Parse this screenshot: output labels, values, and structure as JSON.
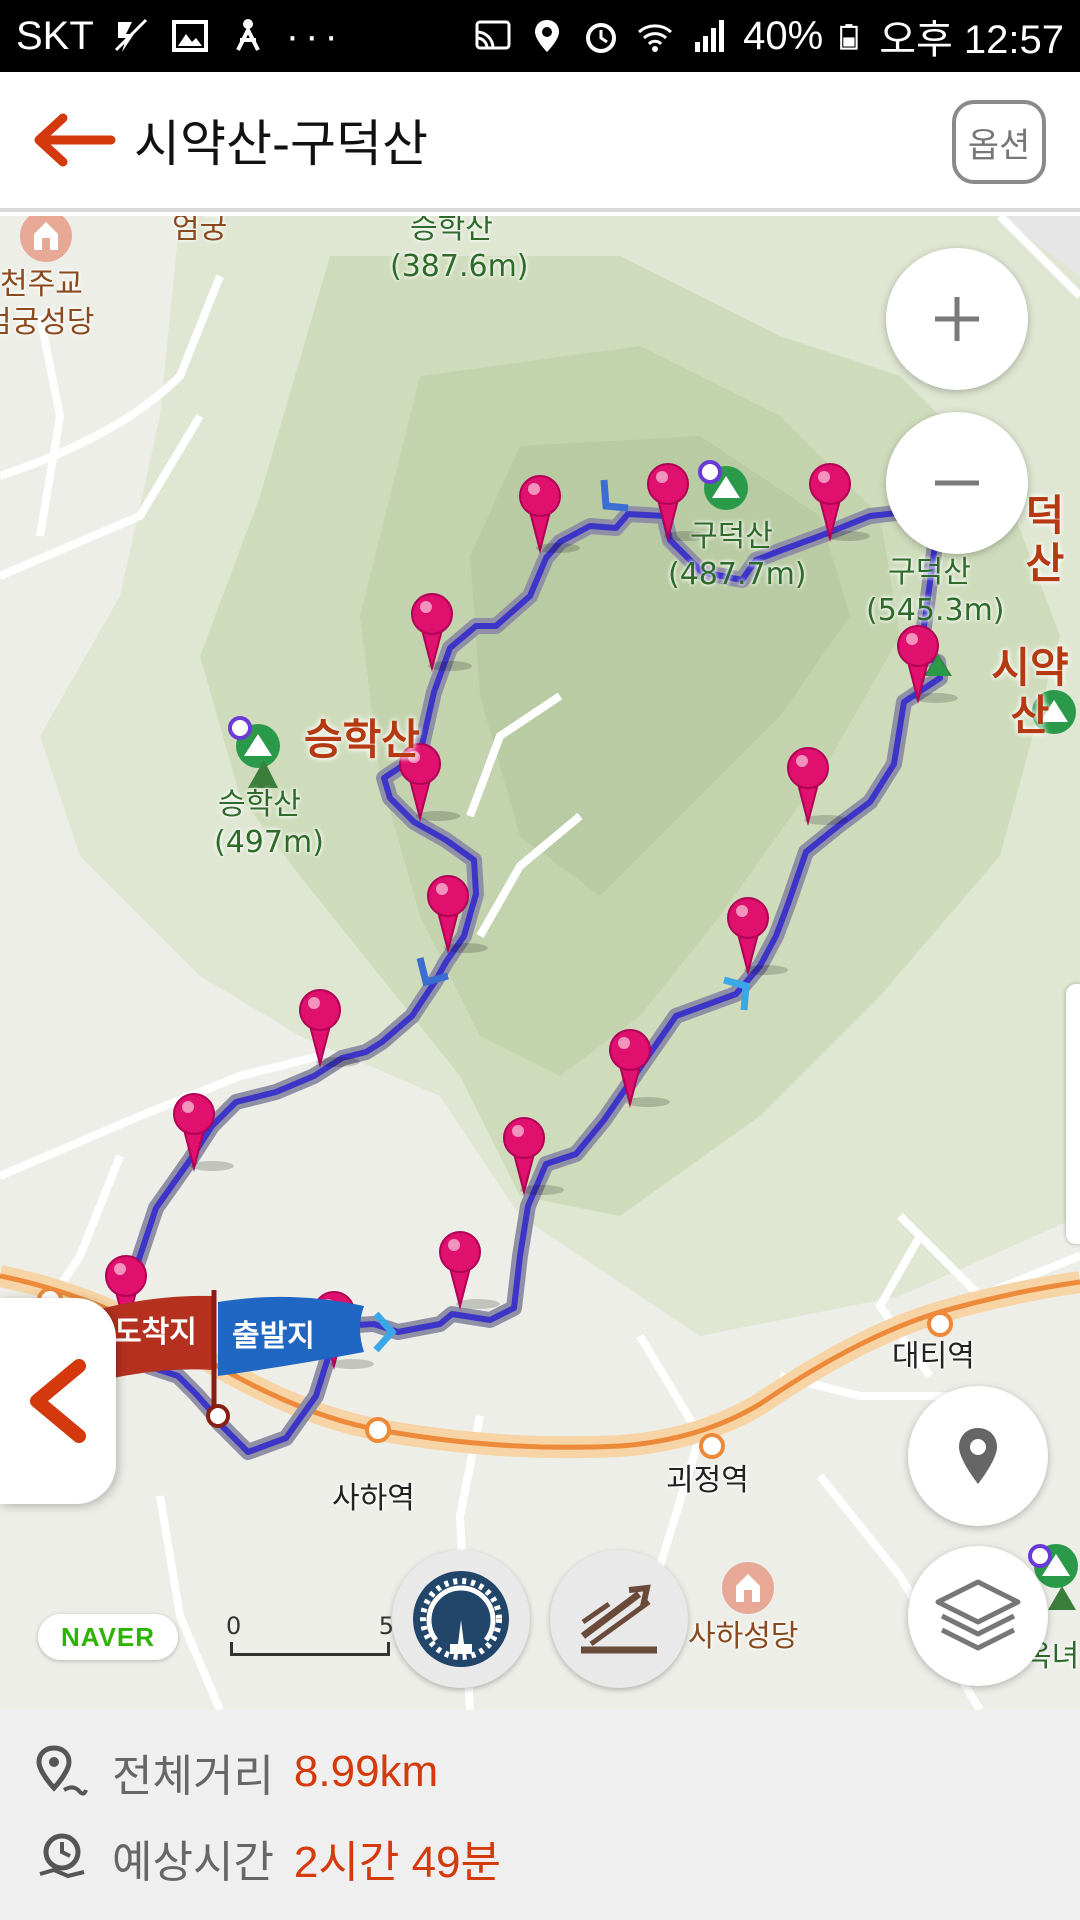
{
  "status_bar": {
    "carrier": "SKT",
    "battery": "40%",
    "time": "오후 12:57",
    "icons": [
      "flash-off-icon",
      "gallery-icon",
      "accessibility-icon",
      "more-icon",
      "cast-icon",
      "location-icon",
      "alarm-icon",
      "wifi-icon",
      "signal-icon",
      "battery-icon"
    ]
  },
  "header": {
    "title": "시약산-구덕산",
    "option_label": "옵션"
  },
  "map": {
    "labels": {
      "cathedral_top_1": "천주교",
      "cathedral_top_2": "엄궁성당",
      "eomgung": "엄궁",
      "seunghaksan_small": "승학산",
      "seunghaksan_small_alt": "(387.6m)",
      "gudeoksan_peak": "구덕산",
      "gudeoksan_peak_alt": "(487.7m)",
      "gudeoksan_2": "구덕산",
      "gudeoksan_2_alt": "(545.3m)",
      "seunghaksan_big": "승학산",
      "seunghaksan_peak": "승학산",
      "seunghaksan_peak_alt": "(497m)",
      "deoksan_big": "덕산",
      "siyaksan_big": "시약산",
      "daeti_station": "대티역",
      "goejeong_station": "괴정역",
      "saha_station": "사하역",
      "saha_church": "사하성당",
      "right_edge_label": "옥녀"
    },
    "flags": {
      "arrival": "도착지",
      "departure": "출발지"
    },
    "branding": "NAVER",
    "scale": {
      "start": "0",
      "end": "5"
    },
    "colors": {
      "route": "#3d35c8",
      "route_outline": "#9a9aa8",
      "pin": "#e0106e",
      "arrival_flag": "#b5301f",
      "departure_flag": "#1f67c2",
      "subway": "#f3a55b"
    }
  },
  "summary": {
    "distance_label": "전체거리",
    "distance_value": "8.99km",
    "time_label": "예상시간",
    "time_value": "2시간 49분"
  }
}
